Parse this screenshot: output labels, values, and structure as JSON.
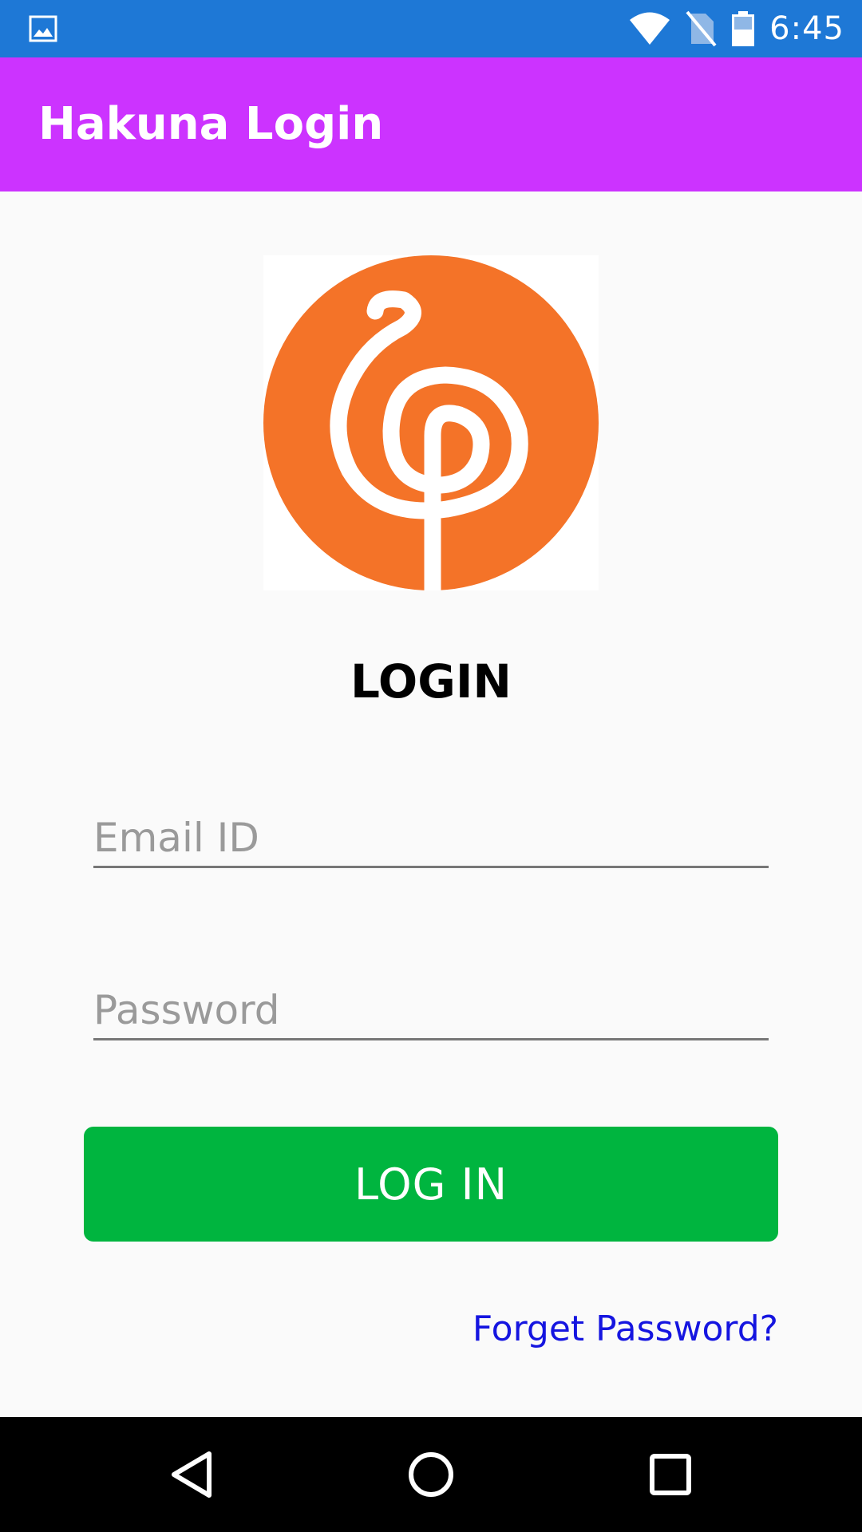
{
  "status_bar": {
    "time": "6:45",
    "left_icon": "image-icon",
    "right_icons": [
      "wifi-icon",
      "no-sim-icon",
      "battery-icon"
    ],
    "color": "#1e78d6"
  },
  "app_bar": {
    "title": "Hakuna Login",
    "color": "#cc33ff"
  },
  "logo": {
    "icon": "hakuna-logo-icon",
    "color": "#f47328"
  },
  "form": {
    "heading": "LOGIN",
    "email_placeholder": "Email ID",
    "email_value": "",
    "password_placeholder": "Password",
    "password_value": "",
    "login_button_label": "LOG IN",
    "login_button_color": "#00b53f",
    "forget_password_label": "Forget Password?",
    "link_color": "#1515e0"
  },
  "nav_bar": {
    "icons": [
      "back-icon",
      "home-icon",
      "recents-icon"
    ]
  }
}
